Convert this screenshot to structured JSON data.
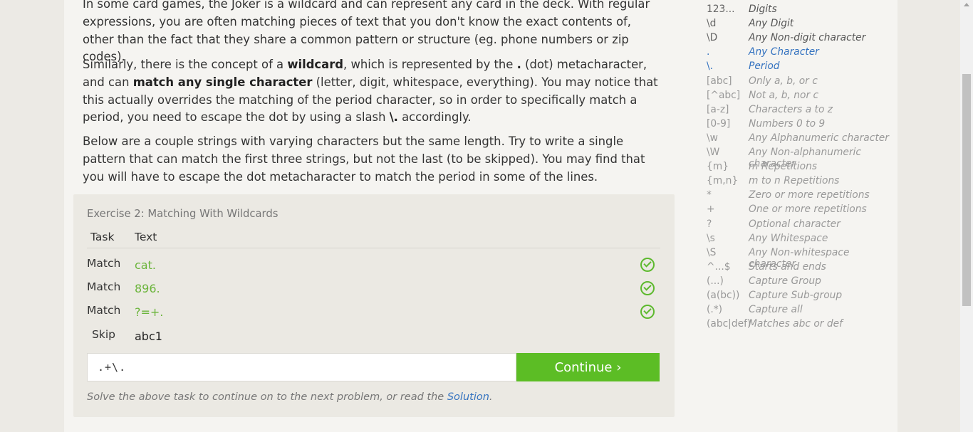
{
  "lesson": {
    "p1": "In some card games, the Joker is a wildcard and can represent any card in the deck. With regular expressions, you are often matching pieces of text that you don't know the exact contents of, other than the fact that they share a common pattern or structure (eg. phone numbers or zip codes).",
    "p2_a": "Similarly, there is the concept of a ",
    "p2_b": "wildcard",
    "p2_c": ", which is represented by the ",
    "p2_d": ".",
    "p2_e": " (dot) metacharacter, and can ",
    "p2_f": "match any single character",
    "p2_g": " (letter, digit, whitespace, everything). You may notice that this actually overrides the matching of the period character, so in order to specifically match a period, you need to escape the dot by using a slash ",
    "p2_h": "\\.",
    "p2_i": " accordingly.",
    "p3": "Below are a couple strings with varying characters but the same length. Try to write a single pattern that can match the first three strings, but not the last (to be skipped). You may find that you will have to escape the dot metacharacter to match the period in some of the lines."
  },
  "exercise": {
    "title": "Exercise 2: Matching With Wildcards",
    "col_task": "Task",
    "col_text": "Text",
    "rows": [
      {
        "task": "Match",
        "text": "cat.",
        "passed": true
      },
      {
        "task": "Match",
        "text": "896.",
        "passed": true
      },
      {
        "task": "Match",
        "text": "?=+.",
        "passed": true
      },
      {
        "task": "Skip",
        "text": "abc1",
        "passed": false
      }
    ],
    "input_value": ".+\\.",
    "continue_label": "Continue ›",
    "hint_prefix": "Solve the above task to continue on to the next problem, or read the ",
    "hint_link": "Solution",
    "hint_suffix": "."
  },
  "reference": [
    {
      "sym": "123...",
      "desc": "Digits"
    },
    {
      "sym": "\\d",
      "desc": "Any Digit"
    },
    {
      "sym": "\\D",
      "desc": "Any Non-digit character"
    },
    {
      "sym": ".",
      "desc": "Any Character"
    },
    {
      "sym": "\\.",
      "desc": "Period"
    },
    {
      "sym": "[abc]",
      "desc": "Only a, b, or c"
    },
    {
      "sym": "[^abc]",
      "desc": "Not a, b, nor c"
    },
    {
      "sym": "[a-z]",
      "desc": "Characters a to z"
    },
    {
      "sym": "[0-9]",
      "desc": "Numbers 0 to 9"
    },
    {
      "sym": "\\w",
      "desc": "Any Alphanumeric character"
    },
    {
      "sym": "\\W",
      "desc": "Any Non-alphanumeric character"
    },
    {
      "sym": "{m}",
      "desc": "m Repetitions"
    },
    {
      "sym": "{m,n}",
      "desc": "m to n Repetitions"
    },
    {
      "sym": "*",
      "desc": "Zero or more repetitions"
    },
    {
      "sym": "+",
      "desc": "One or more repetitions"
    },
    {
      "sym": "?",
      "desc": "Optional character"
    },
    {
      "sym": "\\s",
      "desc": "Any Whitespace"
    },
    {
      "sym": "\\S",
      "desc": "Any Non-whitespace character"
    },
    {
      "sym": "^...$",
      "desc": "Starts and ends"
    },
    {
      "sym": "(...)",
      "desc": "Capture Group"
    },
    {
      "sym": "(a(bc))",
      "desc": "Capture Sub-group"
    },
    {
      "sym": "(.*)",
      "desc": "Capture all"
    },
    {
      "sym": "(abc|def)",
      "desc": "Matches abc or def"
    }
  ],
  "colors": {
    "match_green": "#6ab43a",
    "button_green": "#5cbd25",
    "link_blue": "#3573c0"
  }
}
